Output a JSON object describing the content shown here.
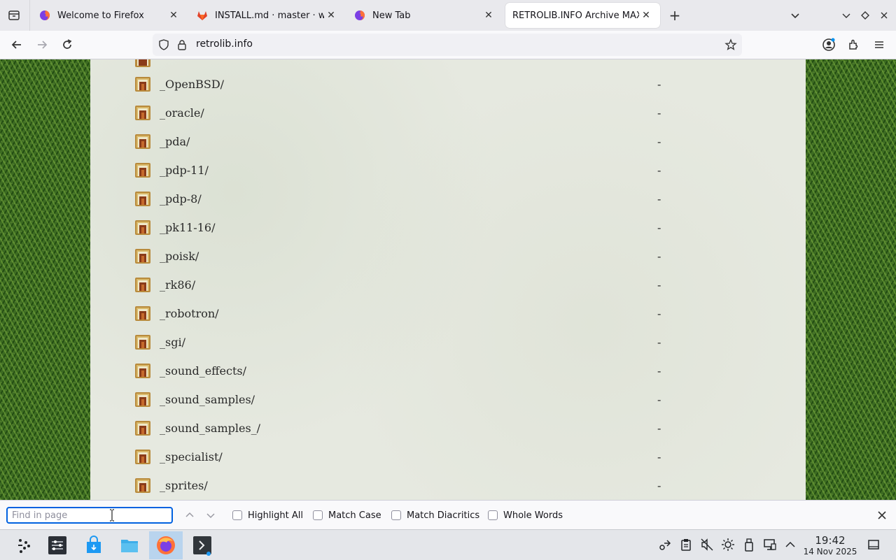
{
  "browser": {
    "tabs": [
      {
        "title": "Welcome to Firefox",
        "icon": "firefox-icon",
        "active": false
      },
      {
        "title": "INSTALL.md · master · wacom",
        "icon": "gitlab-icon",
        "active": false
      },
      {
        "title": "New Tab",
        "icon": "firefox-icon",
        "active": false
      },
      {
        "title": "RETROLIB.INFO Archive MAXIGROUP",
        "icon": "none",
        "active": true
      }
    ],
    "url": "retrolib.info"
  },
  "listing": {
    "rows": [
      {
        "name": "_OpenBSD/",
        "size": "-"
      },
      {
        "name": "_oracle/",
        "size": "-"
      },
      {
        "name": "_pda/",
        "size": "-"
      },
      {
        "name": "_pdp-11/",
        "size": "-"
      },
      {
        "name": "_pdp-8/",
        "size": "-"
      },
      {
        "name": "_pk11-16/",
        "size": "-"
      },
      {
        "name": "_poisk/",
        "size": "-"
      },
      {
        "name": "_rk86/",
        "size": "-"
      },
      {
        "name": "_robotron/",
        "size": "-"
      },
      {
        "name": "_sgi/",
        "size": "-"
      },
      {
        "name": "_sound_effects/",
        "size": "-"
      },
      {
        "name": "_sound_samples/",
        "size": "-"
      },
      {
        "name": "_sound_samples_/",
        "size": "-"
      },
      {
        "name": "_specialist/",
        "size": "-"
      },
      {
        "name": "_sprites/",
        "size": "-"
      }
    ]
  },
  "findbar": {
    "placeholder": "Find in page",
    "value": "",
    "highlight_all": "Highlight All",
    "match_case": "Match Case",
    "match_diacritics": "Match Diacritics",
    "whole_words": "Whole Words"
  },
  "taskbar": {
    "time": "19:42",
    "date": "14 Nov 2025"
  },
  "colors": {
    "accent": "#0061e0",
    "panel_bg": "#e6e9e0",
    "grass": "#3d6b22",
    "taskbar_active": "#b9d4ee"
  }
}
